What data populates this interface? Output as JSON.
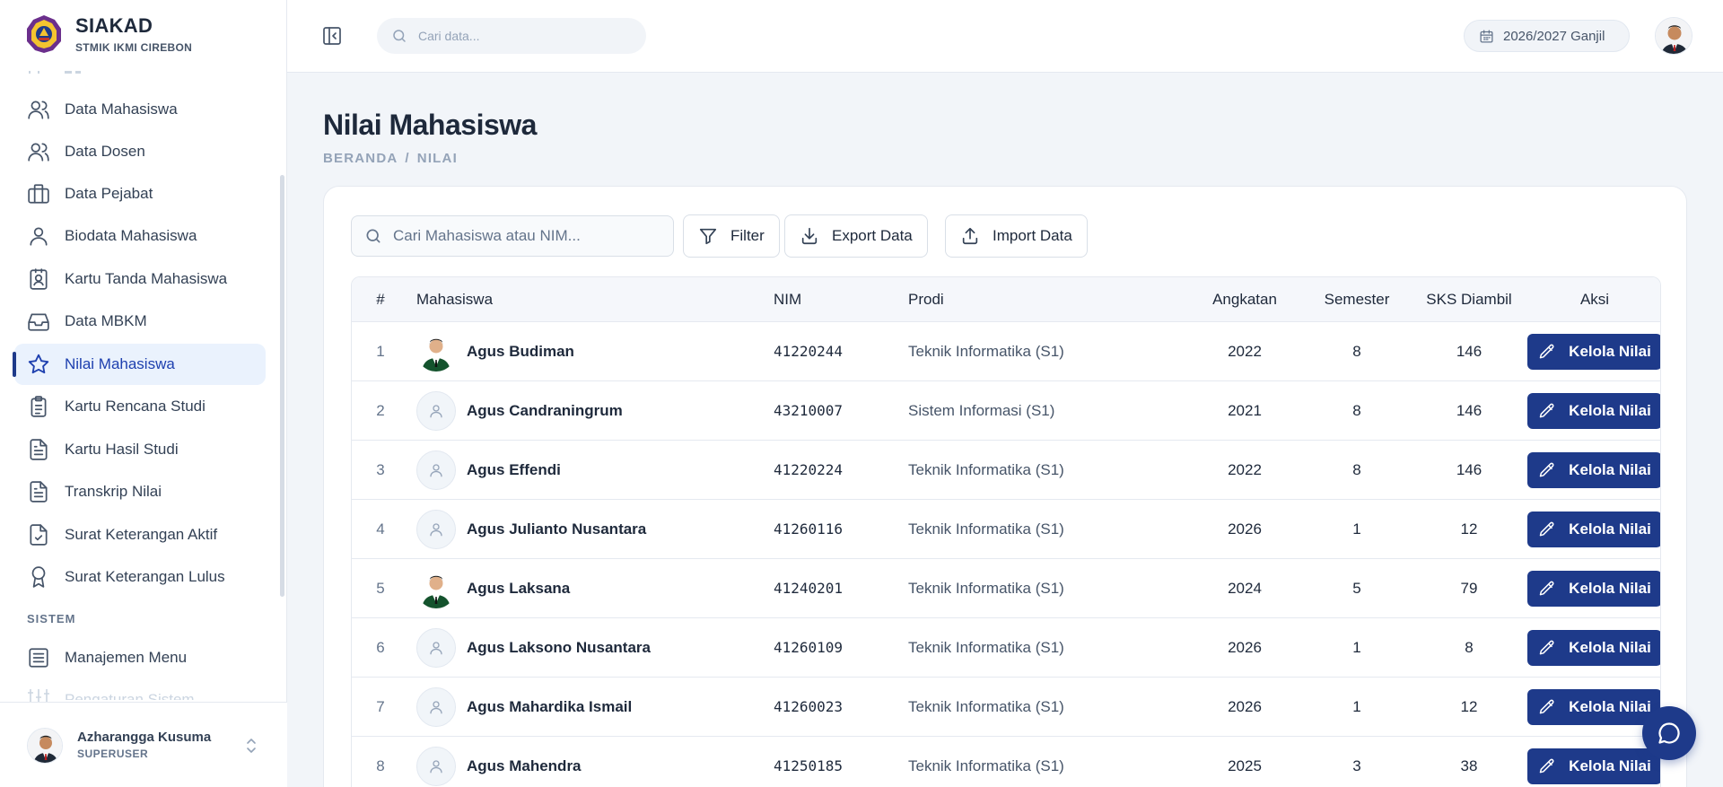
{
  "brand": {
    "title": "SIAKAD",
    "subtitle": "STMIK IKMI CIREBON"
  },
  "sidebar": {
    "items": [
      {
        "label": "Data Mahasiswa",
        "icon": "users-icon"
      },
      {
        "label": "Data Dosen",
        "icon": "users-icon"
      },
      {
        "label": "Data Pejabat",
        "icon": "briefcase-icon"
      },
      {
        "label": "Biodata Mahasiswa",
        "icon": "user-icon"
      },
      {
        "label": "Kartu Tanda Mahasiswa",
        "icon": "id-badge-icon"
      },
      {
        "label": "Data MBKM",
        "icon": "inbox-icon"
      },
      {
        "label": "Nilai Mahasiswa",
        "icon": "star-icon",
        "active": true
      },
      {
        "label": "Kartu Rencana Studi",
        "icon": "clipboard-icon"
      },
      {
        "label": "Kartu Hasil Studi",
        "icon": "file-text-icon"
      },
      {
        "label": "Transkrip Nilai",
        "icon": "file-text-icon"
      },
      {
        "label": "Surat Keterangan Aktif",
        "icon": "file-check-icon"
      },
      {
        "label": "Surat Keterangan Lulus",
        "icon": "award-icon"
      }
    ],
    "section_sistem": "SISTEM",
    "sistem_items": [
      {
        "label": "Manajemen Menu",
        "icon": "list-icon"
      },
      {
        "label": "Pengaturan Sistem",
        "icon": "sliders-icon"
      }
    ]
  },
  "user": {
    "name": "Azharangga Kusuma",
    "role": "SUPERUSER"
  },
  "topbar": {
    "search_placeholder": "Cari data...",
    "period": "2026/2027 Ganjil"
  },
  "page": {
    "title": "Nilai Mahasiswa",
    "breadcrumb": [
      "BERANDA",
      "/",
      "NILAI"
    ]
  },
  "toolbar": {
    "search_placeholder": "Cari Mahasiswa atau NIM...",
    "filter": "Filter",
    "export": "Export Data",
    "import": "Import Data"
  },
  "table": {
    "headers": {
      "no": "#",
      "mahasiswa": "Mahasiswa",
      "nim": "NIM",
      "prodi": "Prodi",
      "angkatan": "Angkatan",
      "semester": "Semester",
      "sks": "SKS Diambil",
      "aksi": "Aksi"
    },
    "action_label": "Kelola Nilai",
    "rows": [
      {
        "no": "1",
        "name": "Agus Budiman",
        "nim": "41220244",
        "prodi": "Teknik Informatika (S1)",
        "angkatan": "2022",
        "semester": "8",
        "sks": "146",
        "photo": true
      },
      {
        "no": "2",
        "name": "Agus Candraningrum",
        "nim": "43210007",
        "prodi": "Sistem Informasi (S1)",
        "angkatan": "2021",
        "semester": "8",
        "sks": "146",
        "photo": false
      },
      {
        "no": "3",
        "name": "Agus Effendi",
        "nim": "41220224",
        "prodi": "Teknik Informatika (S1)",
        "angkatan": "2022",
        "semester": "8",
        "sks": "146",
        "photo": false
      },
      {
        "no": "4",
        "name": "Agus Julianto Nusantara",
        "nim": "41260116",
        "prodi": "Teknik Informatika (S1)",
        "angkatan": "2026",
        "semester": "1",
        "sks": "12",
        "photo": false
      },
      {
        "no": "5",
        "name": "Agus Laksana",
        "nim": "41240201",
        "prodi": "Teknik Informatika (S1)",
        "angkatan": "2024",
        "semester": "5",
        "sks": "79",
        "photo": true
      },
      {
        "no": "6",
        "name": "Agus Laksono Nusantara",
        "nim": "41260109",
        "prodi": "Teknik Informatika (S1)",
        "angkatan": "2026",
        "semester": "1",
        "sks": "8",
        "photo": false
      },
      {
        "no": "7",
        "name": "Agus Mahardika Ismail",
        "nim": "41260023",
        "prodi": "Teknik Informatika (S1)",
        "angkatan": "2026",
        "semester": "1",
        "sks": "12",
        "photo": false
      },
      {
        "no": "8",
        "name": "Agus Mahendra",
        "nim": "41250185",
        "prodi": "Teknik Informatika (S1)",
        "angkatan": "2025",
        "semester": "3",
        "sks": "38",
        "photo": false
      }
    ]
  },
  "colors": {
    "primary": "#1e3a8a",
    "active_bg": "#eaf2fd",
    "page_bg": "#f2f5f9"
  }
}
